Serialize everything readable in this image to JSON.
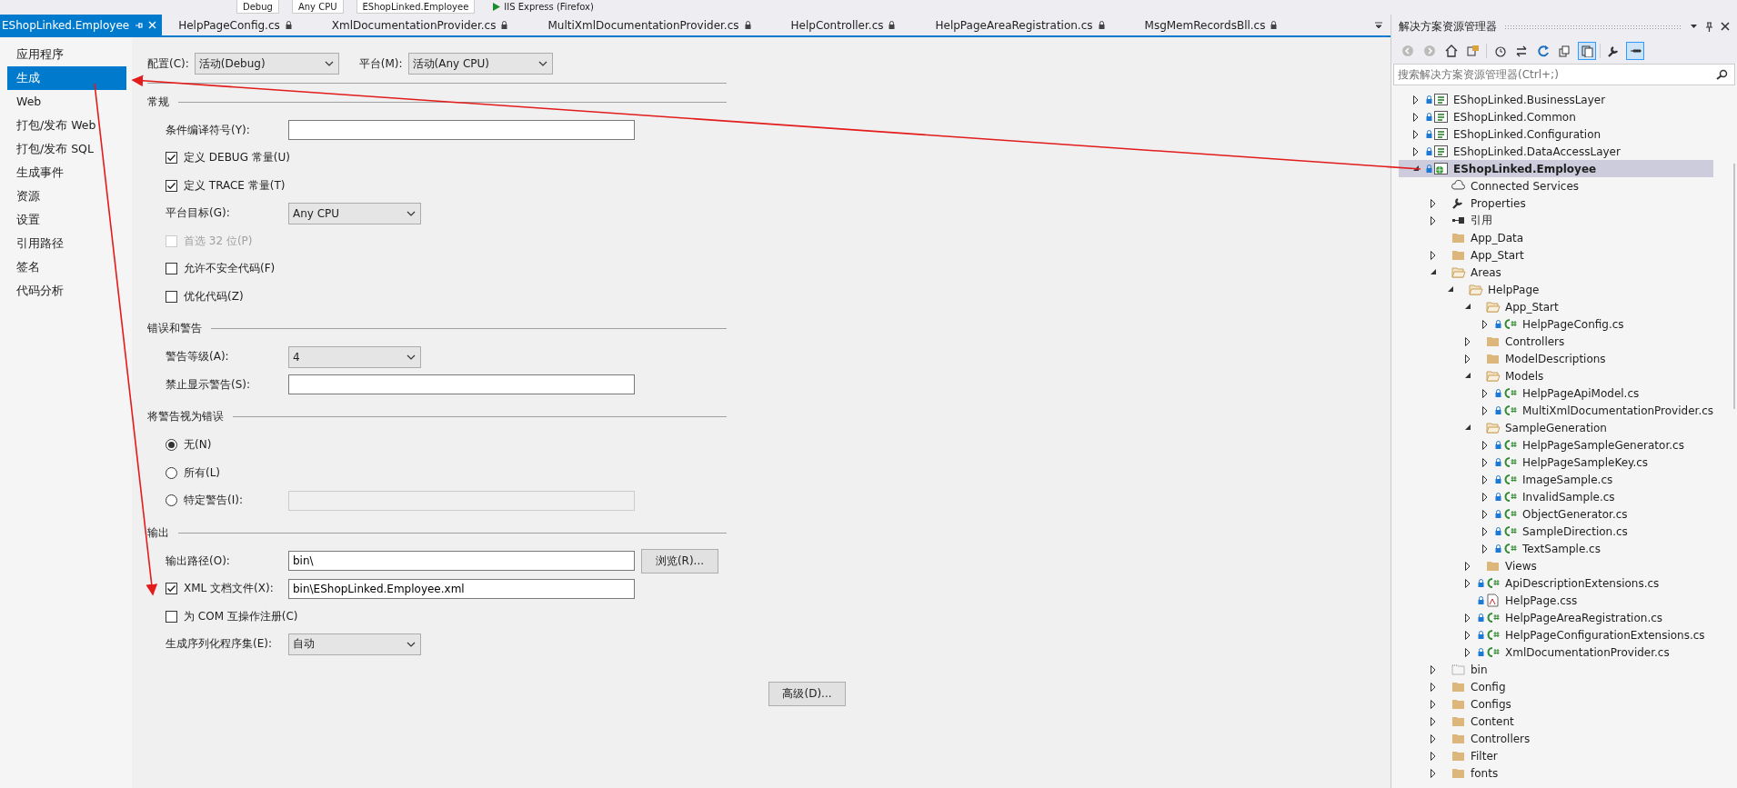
{
  "toolbar": {
    "items": [
      "Debug",
      "Any CPU",
      "EShopLinked.Employee",
      "IIS Express (Firefox)"
    ]
  },
  "tabs": [
    {
      "label": "EShopLinked.Employee",
      "selected": true,
      "kind": "pinned"
    },
    {
      "label": "HelpPageConfig.cs",
      "selected": false,
      "kind": "locked"
    },
    {
      "label": "XmlDocumentationProvider.cs",
      "selected": false,
      "kind": "locked"
    },
    {
      "label": "MultiXmlDocumentationProvider.cs",
      "selected": false,
      "kind": "locked"
    },
    {
      "label": "HelpController.cs",
      "selected": false,
      "kind": "locked"
    },
    {
      "label": "HelpPageAreaRegistration.cs",
      "selected": false,
      "kind": "locked"
    },
    {
      "label": "MsgMemRecordsBll.cs",
      "selected": false,
      "kind": "locked"
    }
  ],
  "nav": {
    "items": [
      {
        "label": "应用程序",
        "selected": false
      },
      {
        "label": "生成",
        "selected": true
      },
      {
        "label": "Web",
        "selected": false
      },
      {
        "label": "打包/发布 Web",
        "selected": false
      },
      {
        "label": "打包/发布 SQL",
        "selected": false
      },
      {
        "label": "生成事件",
        "selected": false
      },
      {
        "label": "资源",
        "selected": false
      },
      {
        "label": "设置",
        "selected": false
      },
      {
        "label": "引用路径",
        "selected": false
      },
      {
        "label": "签名",
        "selected": false
      },
      {
        "label": "代码分析",
        "selected": false
      }
    ]
  },
  "config_bar": {
    "config_label": "配置(C):",
    "config_value": "活动(Debug)",
    "platform_label": "平台(M):",
    "platform_value": "活动(Any CPU)"
  },
  "sections": [
    {
      "title": "常规",
      "rows": [
        {
          "kind": "text",
          "label": "条件编译符号(Y):"
        },
        {
          "kind": "checkbox",
          "label": "定义 DEBUG 常量(U)",
          "checked": true,
          "disabled": false
        },
        {
          "kind": "checkbox",
          "label": "定义 TRACE 常量(T)",
          "checked": true,
          "disabled": false
        },
        {
          "kind": "select",
          "label": "平台目标(G):",
          "value": "Any CPU"
        },
        {
          "kind": "checkbox",
          "label": "首选 32 位(P)",
          "checked": false,
          "disabled": true
        },
        {
          "kind": "checkbox",
          "label": "允许不安全代码(F)",
          "checked": false,
          "disabled": false
        },
        {
          "kind": "checkbox",
          "label": "优化代码(Z)",
          "checked": false,
          "disabled": false
        }
      ]
    },
    {
      "title": "错误和警告",
      "rows": [
        {
          "kind": "select",
          "label": "警告等级(A):",
          "value": "4"
        },
        {
          "kind": "text",
          "label": "禁止显示警告(S):"
        }
      ]
    },
    {
      "title": "将警告视为错误",
      "rows": [
        {
          "kind": "radio",
          "label": "无(N)",
          "selected": true
        },
        {
          "kind": "radio",
          "label": "所有(L)",
          "selected": false
        },
        {
          "kind": "radio-field",
          "label": "特定警告(I):",
          "selected": false,
          "field_disabled": true
        }
      ]
    },
    {
      "title": "输出",
      "rows": [
        {
          "kind": "text-button",
          "label": "输出路径(O):",
          "value": "bin\\",
          "button": "浏览(R)..."
        },
        {
          "kind": "checkbox-text",
          "label": "XML 文档文件(X):",
          "checked": true,
          "value": "bin\\EShopLinked.Employee.xml"
        },
        {
          "kind": "checkbox",
          "label": "为 COM 互操作注册(C)",
          "checked": false,
          "disabled": false
        },
        {
          "kind": "select",
          "label": "生成序列化程序集(E):",
          "value": "自动"
        },
        {
          "kind": "button",
          "button": "高级(D)..."
        }
      ]
    }
  ],
  "solution_explorer": {
    "title": "解决方案资源管理器",
    "search": {
      "placeholder": "搜索解决方案资源管理器(Ctrl+;)"
    },
    "tree": [
      {
        "label": "EShopLinked.BusinessLayer",
        "kind": "csproj",
        "expandable": true,
        "expanded": false,
        "locked": true,
        "selected": false
      },
      {
        "label": "EShopLinked.Common",
        "kind": "csproj",
        "expandable": true,
        "expanded": false,
        "locked": true,
        "selected": false
      },
      {
        "label": "EShopLinked.Configuration",
        "kind": "csproj",
        "expandable": true,
        "expanded": false,
        "locked": true,
        "selected": false
      },
      {
        "label": "EShopLinked.DataAccessLayer",
        "kind": "csproj",
        "expandable": true,
        "expanded": false,
        "locked": true,
        "selected": false
      },
      {
        "label": "EShopLinked.Employee",
        "kind": "webproj",
        "expandable": true,
        "expanded": true,
        "locked": true,
        "selected": true,
        "children": [
          {
            "label": "Connected Services",
            "kind": "service",
            "expandable": false,
            "locked": false,
            "selected": false
          },
          {
            "label": "Properties",
            "kind": "properties",
            "expandable": true,
            "expanded": false,
            "locked": false,
            "selected": false
          },
          {
            "label": "引用",
            "kind": "references",
            "expandable": true,
            "expanded": false,
            "locked": false,
            "selected": false
          },
          {
            "label": "App_Data",
            "kind": "folder",
            "expandable": false,
            "locked": false,
            "selected": false
          },
          {
            "label": "App_Start",
            "kind": "folder",
            "expandable": true,
            "expanded": false,
            "locked": false,
            "selected": false
          },
          {
            "label": "Areas",
            "kind": "folder-open",
            "expandable": true,
            "expanded": true,
            "locked": false,
            "selected": false,
            "children": [
              {
                "label": "HelpPage",
                "kind": "folder-open",
                "expandable": true,
                "expanded": true,
                "locked": false,
                "selected": false,
                "children": [
                  {
                    "label": "App_Start",
                    "kind": "folder-open",
                    "expandable": true,
                    "expanded": true,
                    "locked": false,
                    "selected": false,
                    "children": [
                      {
                        "label": "HelpPageConfig.cs",
                        "kind": "cs",
                        "expandable": true,
                        "expanded": false,
                        "locked": true,
                        "selected": false
                      }
                    ]
                  },
                  {
                    "label": "Controllers",
                    "kind": "folder",
                    "expandable": true,
                    "expanded": false,
                    "locked": false,
                    "selected": false
                  },
                  {
                    "label": "ModelDescriptions",
                    "kind": "folder",
                    "expandable": true,
                    "expanded": false,
                    "locked": false,
                    "selected": false
                  },
                  {
                    "label": "Models",
                    "kind": "folder-open",
                    "expandable": true,
                    "expanded": true,
                    "locked": false,
                    "selected": false,
                    "children": [
                      {
                        "label": "HelpPageApiModel.cs",
                        "kind": "cs",
                        "expandable": true,
                        "expanded": false,
                        "locked": true,
                        "selected": false
                      },
                      {
                        "label": "MultiXmlDocumentationProvider.cs",
                        "kind": "cs",
                        "expandable": true,
                        "expanded": false,
                        "locked": true,
                        "selected": false
                      }
                    ]
                  },
                  {
                    "label": "SampleGeneration",
                    "kind": "folder-open",
                    "expandable": true,
                    "expanded": true,
                    "locked": false,
                    "selected": false,
                    "children": [
                      {
                        "label": "HelpPageSampleGenerator.cs",
                        "kind": "cs",
                        "expandable": true,
                        "expanded": false,
                        "locked": true,
                        "selected": false
                      },
                      {
                        "label": "HelpPageSampleKey.cs",
                        "kind": "cs",
                        "expandable": true,
                        "expanded": false,
                        "locked": true,
                        "selected": false
                      },
                      {
                        "label": "ImageSample.cs",
                        "kind": "cs",
                        "expandable": true,
                        "expanded": false,
                        "locked": true,
                        "selected": false
                      },
                      {
                        "label": "InvalidSample.cs",
                        "kind": "cs",
                        "expandable": true,
                        "expanded": false,
                        "locked": true,
                        "selected": false
                      },
                      {
                        "label": "ObjectGenerator.cs",
                        "kind": "cs",
                        "expandable": true,
                        "expanded": false,
                        "locked": true,
                        "selected": false
                      },
                      {
                        "label": "SampleDirection.cs",
                        "kind": "cs",
                        "expandable": true,
                        "expanded": false,
                        "locked": true,
                        "selected": false
                      },
                      {
                        "label": "TextSample.cs",
                        "kind": "cs",
                        "expandable": true,
                        "expanded": false,
                        "locked": true,
                        "selected": false
                      }
                    ]
                  },
                  {
                    "label": "Views",
                    "kind": "folder",
                    "expandable": true,
                    "expanded": false,
                    "locked": false,
                    "selected": false
                  },
                  {
                    "label": "ApiDescriptionExtensions.cs",
                    "kind": "cs",
                    "expandable": true,
                    "expanded": false,
                    "locked": true,
                    "selected": false
                  },
                  {
                    "label": "HelpPage.css",
                    "kind": "css",
                    "expandable": false,
                    "locked": true,
                    "selected": false
                  },
                  {
                    "label": "HelpPageAreaRegistration.cs",
                    "kind": "cs",
                    "expandable": true,
                    "expanded": false,
                    "locked": true,
                    "selected": false
                  },
                  {
                    "label": "HelpPageConfigurationExtensions.cs",
                    "kind": "cs",
                    "expandable": true,
                    "expanded": false,
                    "locked": true,
                    "selected": false
                  },
                  {
                    "label": "XmlDocumentationProvider.cs",
                    "kind": "cs",
                    "expandable": true,
                    "expanded": false,
                    "locked": true,
                    "selected": false
                  }
                ]
              }
            ]
          },
          {
            "label": "bin",
            "kind": "folder-dotted",
            "expandable": true,
            "expanded": false,
            "locked": false,
            "selected": false
          },
          {
            "label": "Config",
            "kind": "folder",
            "expandable": true,
            "expanded": false,
            "locked": false,
            "selected": false
          },
          {
            "label": "Configs",
            "kind": "folder",
            "expandable": true,
            "expanded": false,
            "locked": false,
            "selected": false
          },
          {
            "label": "Content",
            "kind": "folder",
            "expandable": true,
            "expanded": false,
            "locked": false,
            "selected": false
          },
          {
            "label": "Controllers",
            "kind": "folder",
            "expandable": true,
            "expanded": false,
            "locked": false,
            "selected": false
          },
          {
            "label": "Filter",
            "kind": "folder",
            "expandable": true,
            "expanded": false,
            "locked": false,
            "selected": false
          },
          {
            "label": "fonts",
            "kind": "folder",
            "expandable": true,
            "expanded": false,
            "locked": false,
            "selected": false
          }
        ]
      }
    ]
  }
}
